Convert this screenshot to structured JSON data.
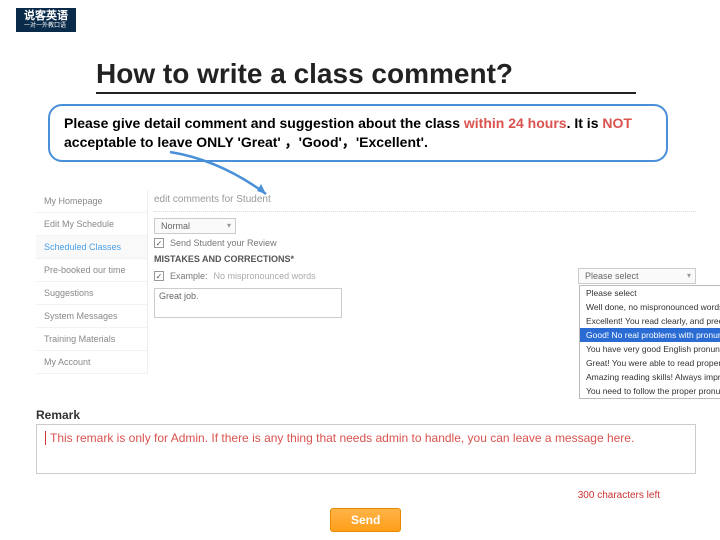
{
  "logo": {
    "main": "说客英语",
    "sub": "一对一外教口语"
  },
  "title": "How to write a class comment?",
  "instruction": {
    "pre": "Please give detail comment and suggestion about the class ",
    "within": "within 24 hours",
    "post1": ". It is ",
    "not": "NOT",
    "post2": " acceptable to leave ONLY 'Great' ，'Good'，'Excellent'."
  },
  "sidebar": {
    "items": [
      {
        "label": "My Homepage"
      },
      {
        "label": "Edit My Schedule"
      },
      {
        "label": "Scheduled Classes",
        "active": true
      },
      {
        "label": "Pre-booked our time"
      },
      {
        "label": "Suggestions"
      },
      {
        "label": "System Messages"
      },
      {
        "label": "Training Materials"
      },
      {
        "label": "My Account"
      }
    ]
  },
  "main": {
    "edit_title": "edit comments for Student",
    "level_select": "Normal",
    "send_student": "Send Student your Review",
    "mistakes_hdr": "MISTAKES AND CORRECTIONS*",
    "example_label": "Example:",
    "example_text": "No mispronounced words",
    "select_placeholder": "Please select",
    "textbox_value": "Great job.",
    "dropdown_options": [
      "Please select",
      "Well done, no mispronounced words",
      "Excellent! You read clearly, and precisely",
      "Good! No real problems with pronunciation today",
      "You have very good English pronunciation skills.",
      "Great! You were able to read properly.",
      "Amazing reading skills! Always impresses me so much!",
      "You need to follow the proper pronunciation of words"
    ]
  },
  "remark": {
    "label": "Remark",
    "text": "This remark is only for Admin. If there is any  thing that needs admin to handle, you can leave a message here."
  },
  "char_left": "300 characters left",
  "send": "Send"
}
